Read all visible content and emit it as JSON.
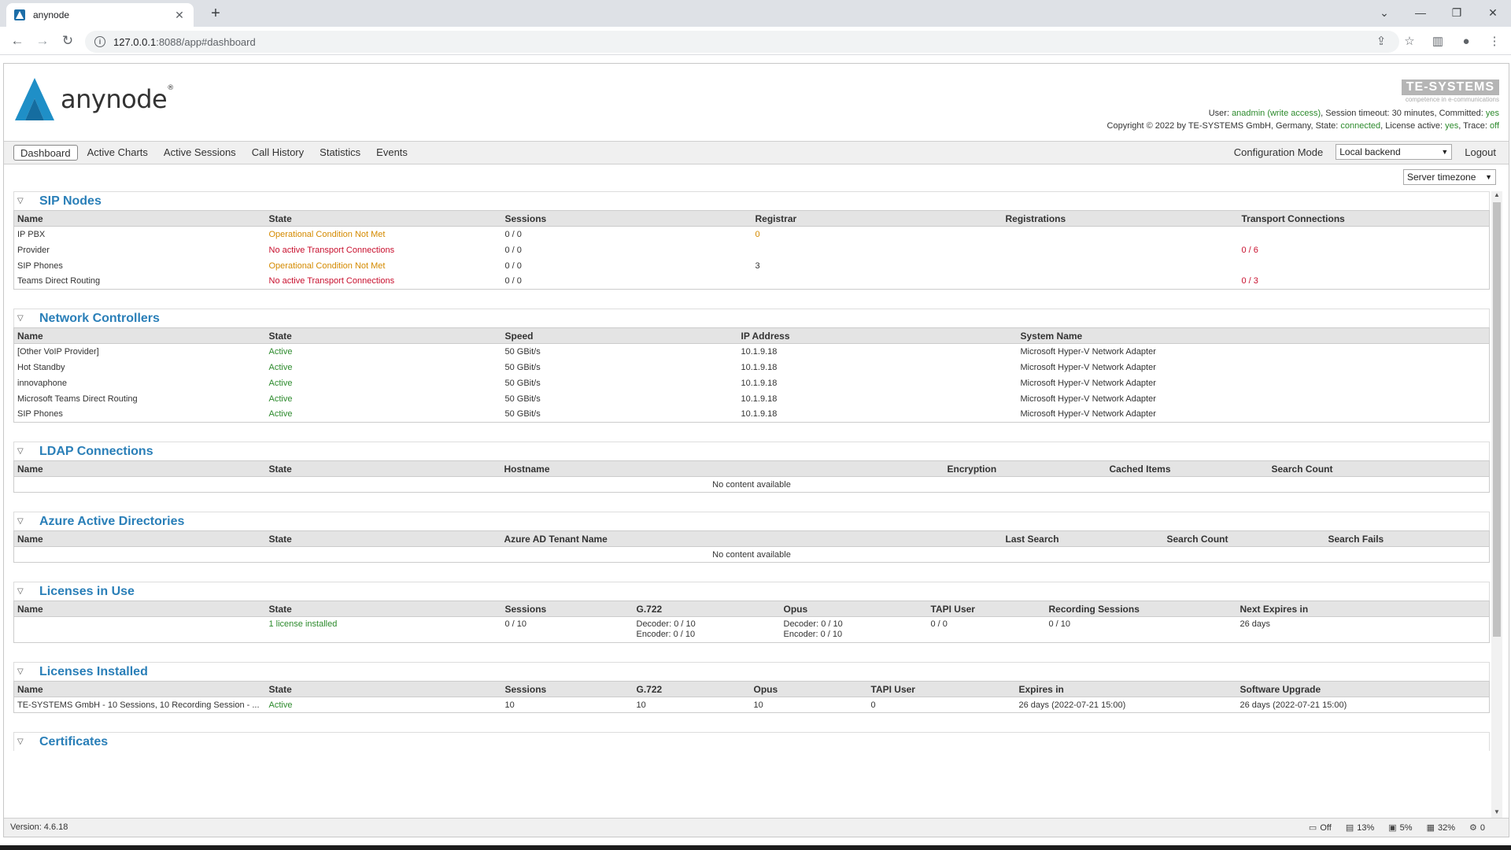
{
  "browser": {
    "tab_title": "anynode",
    "url_host": "127.0.0.1",
    "url_rest": ":8088/app#dashboard"
  },
  "header": {
    "logo_text": "anynode",
    "brand_name": "TE-SYSTEMS",
    "brand_sub": "competence in e-communications",
    "user_label": "User: ",
    "user": "anadmin",
    "access": "(write access)",
    "session_timeout": ", Session timeout: 30 minutes, Committed: ",
    "committed": "yes",
    "copyright": "Copyright © 2022 by TE-SYSTEMS GmbH, Germany, State: ",
    "state": "connected",
    "license_label": ", License active: ",
    "license_active": "yes",
    "trace_label": ", Trace: ",
    "trace": "off"
  },
  "menu": {
    "items": [
      "Dashboard",
      "Active Charts",
      "Active Sessions",
      "Call History",
      "Statistics",
      "Events"
    ],
    "config_mode": "Configuration Mode",
    "backend_select": "Local backend",
    "logout": "Logout",
    "timezone_select": "Server timezone"
  },
  "sip_nodes": {
    "title": "SIP Nodes",
    "columns": [
      "Name",
      "State",
      "Sessions",
      "Registrar",
      "Registrations",
      "Transport Connections"
    ],
    "rows": [
      [
        "IP PBX",
        "Operational Condition Not Met",
        "0 / 0",
        "0",
        "",
        ""
      ],
      [
        "Provider",
        "No active Transport Connections",
        "0 / 0",
        "",
        "",
        "0 / 6"
      ],
      [
        "SIP Phones",
        "Operational Condition Not Met",
        "0 / 0",
        "3",
        "",
        ""
      ],
      [
        "Teams Direct Routing",
        "No active Transport Connections",
        "0 / 0",
        "",
        "",
        "0 / 3"
      ]
    ]
  },
  "network_controllers": {
    "title": "Network Controllers",
    "columns": [
      "Name",
      "State",
      "Speed",
      "IP Address",
      "System Name"
    ],
    "rows": [
      [
        "[Other VoIP Provider]",
        "Active",
        "50 GBit/s",
        "10.1.9.18",
        "Microsoft Hyper-V Network Adapter"
      ],
      [
        "Hot Standby",
        "Active",
        "50 GBit/s",
        "10.1.9.18",
        "Microsoft Hyper-V Network Adapter"
      ],
      [
        "innovaphone",
        "Active",
        "50 GBit/s",
        "10.1.9.18",
        "Microsoft Hyper-V Network Adapter"
      ],
      [
        "Microsoft Teams Direct Routing",
        "Active",
        "50 GBit/s",
        "10.1.9.18",
        "Microsoft Hyper-V Network Adapter"
      ],
      [
        "SIP Phones",
        "Active",
        "50 GBit/s",
        "10.1.9.18",
        "Microsoft Hyper-V Network Adapter"
      ]
    ]
  },
  "ldap": {
    "title": "LDAP Connections",
    "columns": [
      "Name",
      "State",
      "Hostname",
      "Encryption",
      "Cached Items",
      "Search Count"
    ],
    "empty": "No content available"
  },
  "azure": {
    "title": "Azure Active Directories",
    "columns": [
      "Name",
      "State",
      "Azure AD Tenant Name",
      "Last Search",
      "Search Count",
      "Search Fails"
    ],
    "empty": "No content available"
  },
  "licenses_in_use": {
    "title": "Licenses in Use",
    "columns": [
      "Name",
      "State",
      "Sessions",
      "G.722",
      "Opus",
      "TAPI User",
      "Recording Sessions",
      "Next Expires in"
    ],
    "row": {
      "name": "",
      "state": "1 license installed",
      "sessions": "0 / 10",
      "g722_dec": "Decoder: 0 / 10",
      "g722_enc": "Encoder: 0 / 10",
      "opus_dec": "Decoder: 0 / 10",
      "opus_enc": "Encoder: 0 / 10",
      "tapi": "0 / 0",
      "recording": "0 / 10",
      "expires": "26 days"
    }
  },
  "licenses_installed": {
    "title": "Licenses Installed",
    "columns": [
      "Name",
      "State",
      "Sessions",
      "G.722",
      "Opus",
      "TAPI User",
      "Expires in",
      "Software Upgrade"
    ],
    "rows": [
      [
        "TE-SYSTEMS GmbH - 10 Sessions, 10 Recording Session - ...",
        "Active",
        "10",
        "10",
        "10",
        "0",
        "26 days (2022-07-21 15:00)",
        "26 days (2022-07-21 15:00)"
      ]
    ]
  },
  "certificates": {
    "title": "Certificates"
  },
  "statusbar": {
    "version": "Version: 4.6.18",
    "items": [
      "Off",
      "13%",
      "5%",
      "32%",
      "0"
    ]
  }
}
